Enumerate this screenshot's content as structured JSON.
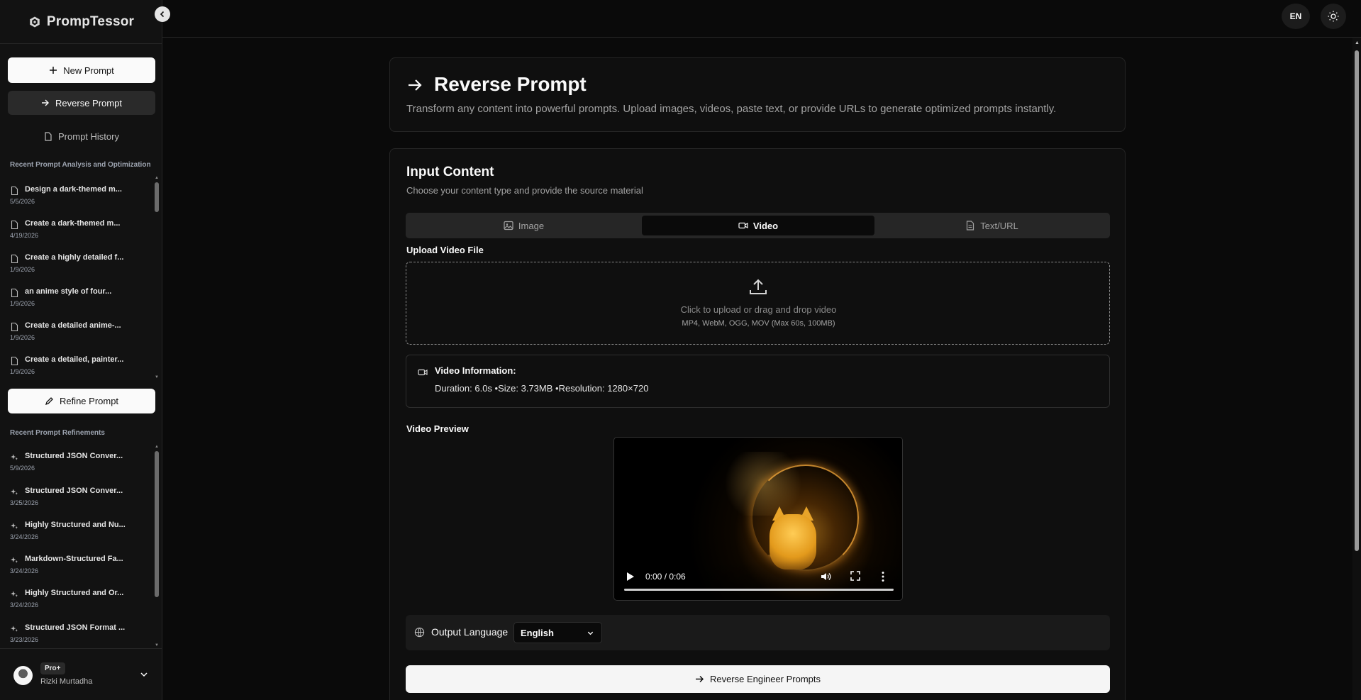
{
  "app": {
    "name": "PrompTessor"
  },
  "sidebar": {
    "new_prompt": "New Prompt",
    "reverse_prompt": "Reverse Prompt",
    "prompt_history": "Prompt History",
    "analysis_section": "Recent Prompt Analysis and Optimization",
    "analysis_items": [
      {
        "title": "Design a dark-themed m...",
        "date": "5/5/2026"
      },
      {
        "title": "Create a dark-themed m...",
        "date": "4/19/2026"
      },
      {
        "title": "Create a highly detailed f...",
        "date": "1/9/2026"
      },
      {
        "title": "an anime style of four...",
        "date": "1/9/2026"
      },
      {
        "title": "Create a detailed anime-...",
        "date": "1/9/2026"
      },
      {
        "title": "Create a detailed, painter...",
        "date": "1/9/2026"
      }
    ],
    "refine_prompt": "Refine Prompt",
    "refinements_section": "Recent Prompt Refinements",
    "refinement_items": [
      {
        "title": "Structured JSON Conver...",
        "date": "5/9/2026"
      },
      {
        "title": "Structured JSON Conver...",
        "date": "3/25/2026"
      },
      {
        "title": "Highly Structured and Nu...",
        "date": "3/24/2026"
      },
      {
        "title": "Markdown-Structured Fa...",
        "date": "3/24/2026"
      },
      {
        "title": "Highly Structured and Or...",
        "date": "3/24/2026"
      },
      {
        "title": "Structured JSON Format ...",
        "date": "3/23/2026"
      }
    ],
    "user": {
      "plan": "Pro+",
      "name": "Rizki Murtadha"
    }
  },
  "topbar": {
    "language": "EN"
  },
  "page": {
    "title": "Reverse Prompt",
    "subtitle": "Transform any content into powerful prompts. Upload images, videos, paste text, or provide URLs to generate optimized prompts instantly."
  },
  "input": {
    "title": "Input Content",
    "subtitle": "Choose your content type and provide the source material",
    "tabs": [
      {
        "label": "Image",
        "icon": "image-icon",
        "active": false
      },
      {
        "label": "Video",
        "icon": "video-icon",
        "active": true
      },
      {
        "label": "Text/URL",
        "icon": "file-text-icon",
        "active": false
      }
    ],
    "upload_label": "Upload Video File",
    "upload_text": "Click to upload or drag and drop video",
    "upload_hint": "MP4, WebM, OGG, MOV (Max 60s, 100MB)",
    "video_info_title": "Video Information:",
    "video_info_detail": "Duration: 6.0s •Size: 3.73MB •Resolution: 1280×720",
    "preview_label": "Video Preview",
    "player": {
      "time": "0:00 / 0:06",
      "progress": 0
    },
    "output_language_label": "Output Language",
    "output_language_value": "English",
    "submit": "Reverse Engineer Prompts"
  },
  "colors": {
    "background": "#0a0a0a",
    "card": "#0f0f0f",
    "border": "#262626",
    "primary_button": "#fafafa",
    "muted_text": "#a3a3a3",
    "accent_glow": "#ffaa28"
  }
}
